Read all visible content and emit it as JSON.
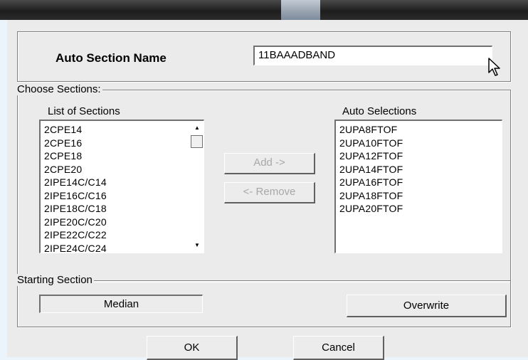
{
  "dialog": {
    "auto_section_name_label": "Auto Section Name",
    "auto_section_name_value": "11BAAADBAND",
    "choose_sections_legend": "Choose Sections:",
    "list_of_sections_label": "List of Sections",
    "auto_selections_label": "Auto Selections",
    "list_of_sections": [
      "2CPE14",
      "2CPE16",
      "2CPE18",
      "2CPE20",
      "2IPE14C/C14",
      "2IPE16C/C16",
      "2IPE18C/C18",
      "2IPE20C/C20",
      "2IPE22C/C22",
      "2IPE24C/C24"
    ],
    "auto_selections": [
      "2UPA8FTOF",
      "2UPA10FTOF",
      "2UPA12FTOF",
      "2UPA14FTOF",
      "2UPA16FTOF",
      "2UPA18FTOF",
      "2UPA20FTOF"
    ],
    "add_button": "Add ->",
    "remove_button": "<- Remove",
    "starting_section_legend": "Starting Section",
    "starting_section_value": "Median",
    "overwrite_button": "Overwrite",
    "ok_button": "OK",
    "cancel_button": "Cancel"
  },
  "colors": {
    "titlebar": "#1e1e1e",
    "dialog_bg": "#ebebeb",
    "disabled_text": "#a8a8a8"
  },
  "icons": [
    "mouse-pointer-icon",
    "scroll-up-arrow-icon",
    "scroll-down-arrow-icon"
  ]
}
